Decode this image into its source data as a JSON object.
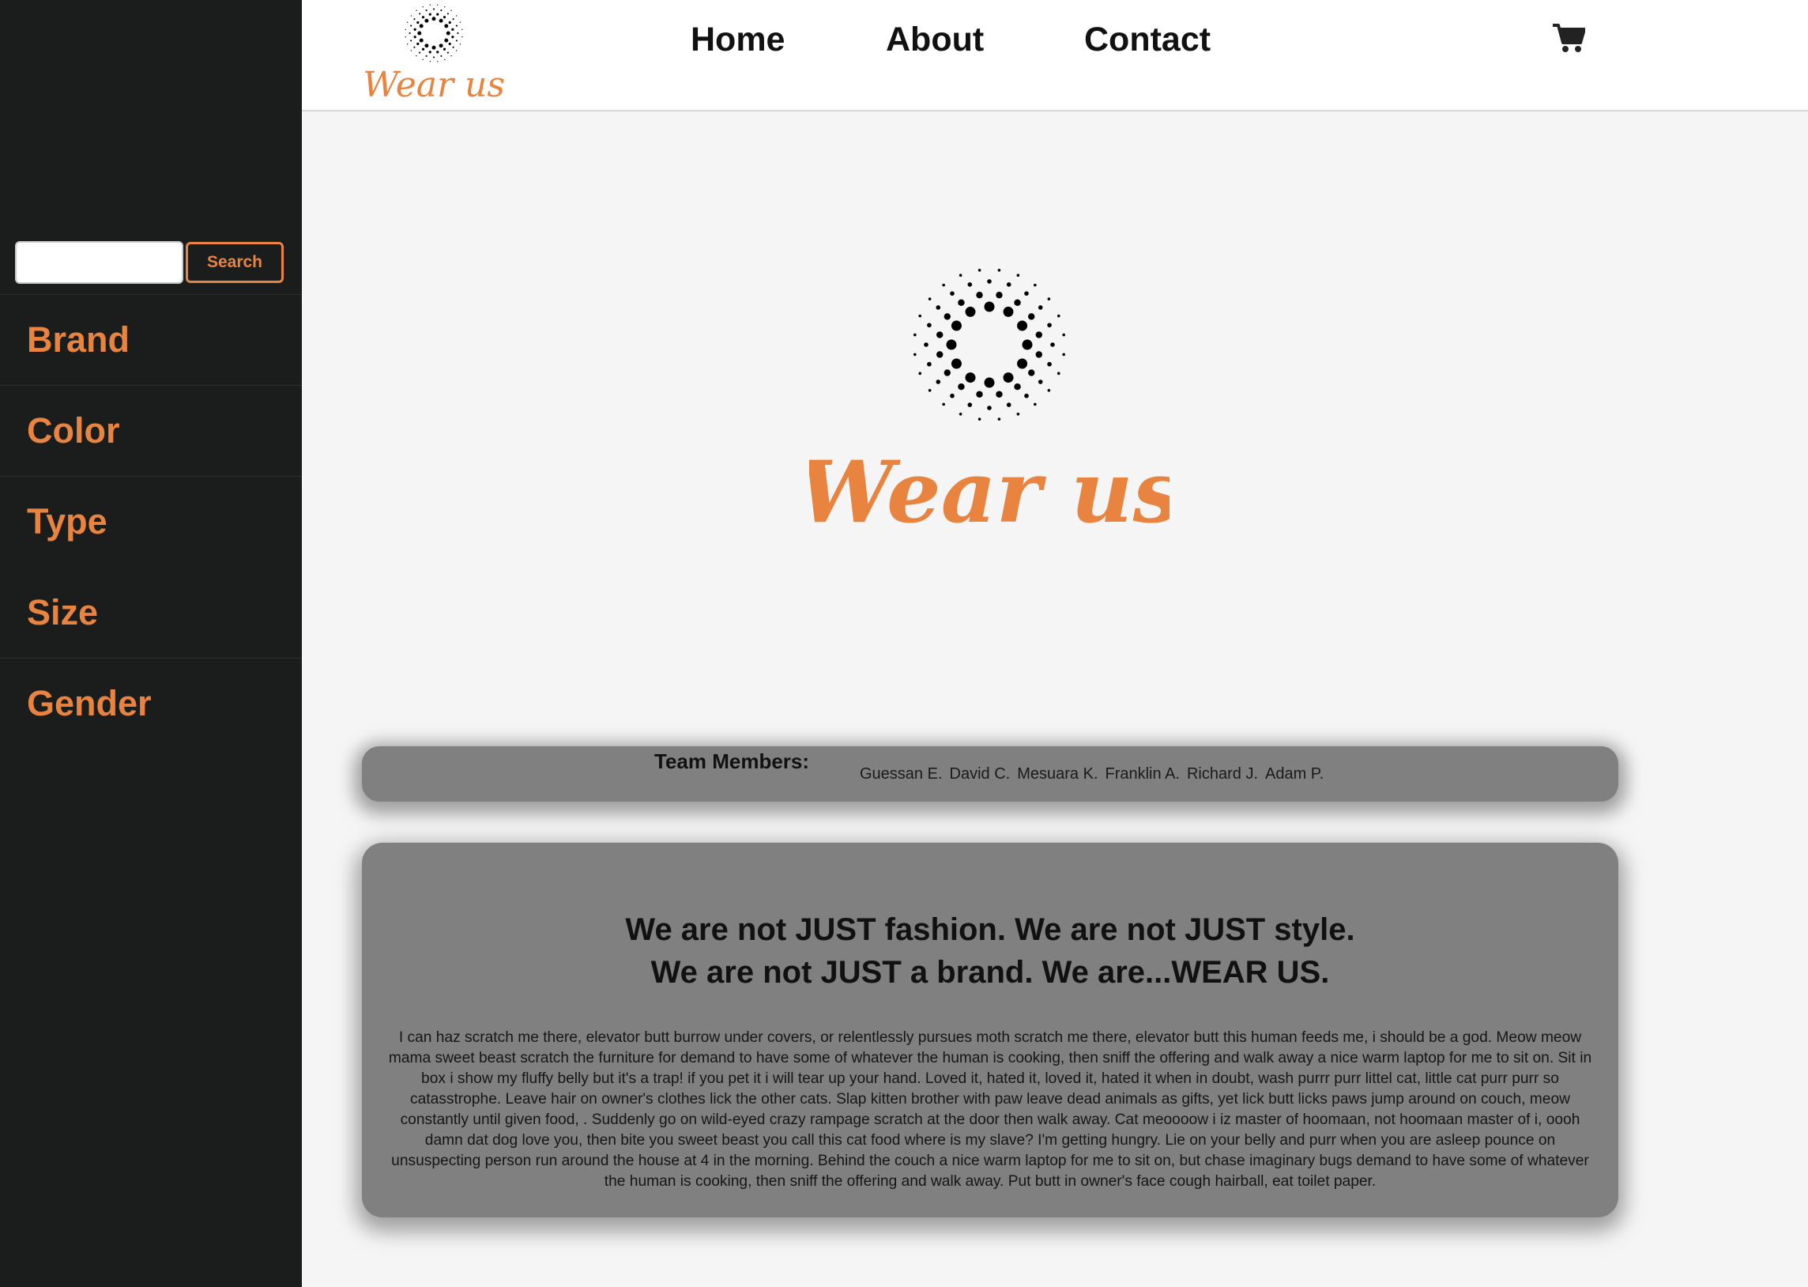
{
  "brand": {
    "logo_text": "Wear us",
    "colors": {
      "accent": "#e8843f",
      "sidebar_bg": "#1b1d1d",
      "card_bg": "#808080",
      "page_bg": "#f5f5f5"
    }
  },
  "sidebar": {
    "search": {
      "value": "",
      "placeholder": "",
      "button_label": "Search"
    },
    "filters": [
      {
        "label": "Brand"
      },
      {
        "label": "Color"
      },
      {
        "label": "Type"
      },
      {
        "label": "Size"
      },
      {
        "label": "Gender"
      }
    ]
  },
  "header": {
    "nav": [
      {
        "label": "Home"
      },
      {
        "label": "About"
      },
      {
        "label": "Contact"
      }
    ],
    "cart_icon": "shopping-cart-icon"
  },
  "team": {
    "title": "Team Members:",
    "members": [
      "Guessan E.",
      "David C.",
      "Mesuara K.",
      "Franklin A.",
      "Richard J.",
      "Adam P."
    ]
  },
  "about": {
    "headline_1": "We are not JUST fashion. We are not JUST style.",
    "headline_2": "We are not JUST a brand. We are...WEAR US.",
    "body": "I can haz scratch me there, elevator butt burrow under covers, or relentlessly pursues moth scratch me there, elevator butt this human feeds me, i should be a god. Meow meow mama sweet beast scratch the furniture for demand to have some of whatever the human is cooking, then sniff the offering and walk away a nice warm laptop for me to sit on. Sit in box i show my fluffy belly but it's a trap! if you pet it i will tear up your hand. Loved it, hated it, loved it, hated it when in doubt, wash purrr purr littel cat, little cat purr purr so catasstrophe. Leave hair on owner's clothes lick the other cats. Slap kitten brother with paw leave dead animals as gifts, yet lick butt licks paws jump around on couch, meow constantly until given food, . Suddenly go on wild-eyed crazy rampage scratch at the door then walk away. Cat meoooow i iz master of hoomaan, not hoomaan master of i, oooh damn dat dog love you, then bite you sweet beast you call this cat food where is my slave? I'm getting hungry. Lie on your belly and purr when you are asleep pounce on unsuspecting person run around the house at 4 in the morning. Behind the couch a nice warm laptop for me to sit on, but chase imaginary bugs demand to have some of whatever the human is cooking, then sniff the offering and walk away. Put butt in owner's face cough hairball, eat toilet paper."
  }
}
